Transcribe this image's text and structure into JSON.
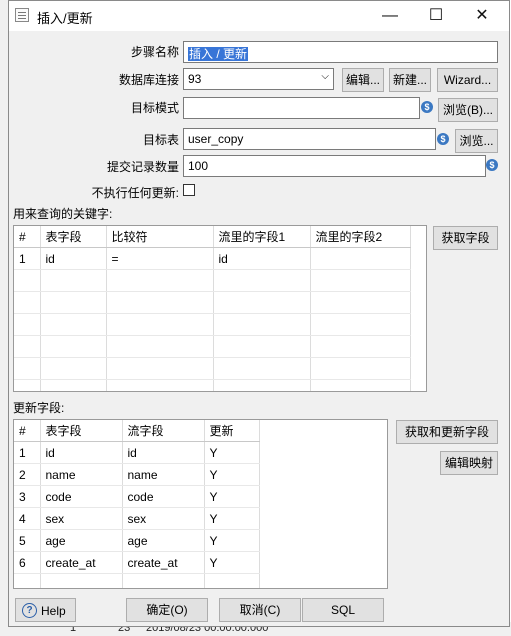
{
  "window": {
    "title": "插入/更新",
    "minimize_glyph": "—",
    "maximize_glyph": "☐",
    "close_glyph": "✕"
  },
  "form": {
    "step_name_label": "步骤名称",
    "step_name": "插入 / 更新",
    "connection_label": "数据库连接",
    "connection": "93",
    "edit_button": "编辑...",
    "new_button": "新建...",
    "wizard_button": "Wizard...",
    "schema_label": "目标模式",
    "schema": "",
    "browse_schema_button": "浏览(B)...",
    "table_label": "目标表",
    "table": "user_copy",
    "browse_table_button": "浏览...",
    "commit_label": "提交记录数量",
    "commit": "100",
    "no_update_label": "不执行任何更新:"
  },
  "keys": {
    "label": "用来查询的关键字:",
    "get_button": "获取字段",
    "columns": [
      "#",
      "表字段",
      "比较符",
      "流里的字段1",
      "流里的字段2"
    ],
    "rows": [
      [
        "1",
        "id",
        "=",
        "id",
        ""
      ]
    ]
  },
  "update": {
    "label": "更新字段:",
    "get_update_button": "获取和更新字段",
    "edit_mapping_button": "编辑映射",
    "columns": [
      "#",
      "表字段",
      "流字段",
      "更新"
    ],
    "rows": [
      [
        "1",
        "id",
        "id",
        "Y"
      ],
      [
        "2",
        "name",
        "name",
        "Y"
      ],
      [
        "3",
        "code",
        "code",
        "Y"
      ],
      [
        "4",
        "sex",
        "sex",
        "Y"
      ],
      [
        "5",
        "age",
        "age",
        "Y"
      ],
      [
        "6",
        "create_at",
        "create_at",
        "Y"
      ]
    ]
  },
  "footer": {
    "help_button": "Help",
    "ok_button": "确定(O)",
    "cancel_button": "取消(C)",
    "sql_button": "SQL"
  },
  "background": {
    "bottom_values": [
      "1",
      "23",
      "2019/08/23 00:00:00.000"
    ]
  }
}
